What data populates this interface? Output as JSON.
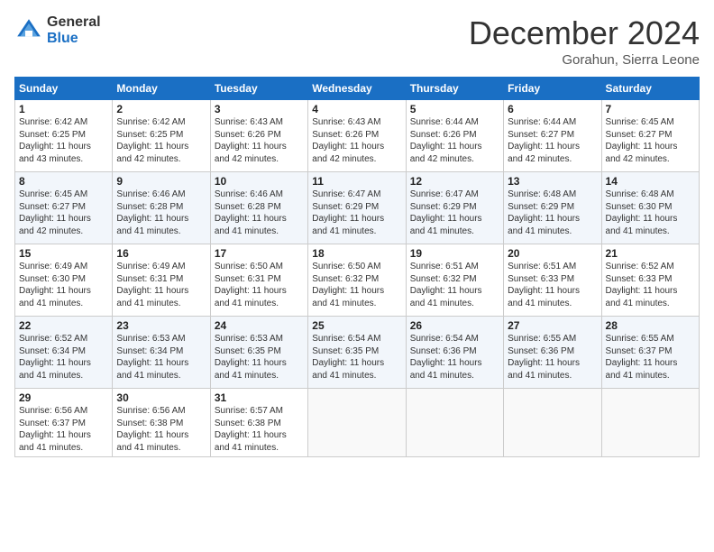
{
  "logo": {
    "general": "General",
    "blue": "Blue"
  },
  "title": "December 2024",
  "subtitle": "Gorahun, Sierra Leone",
  "days_of_week": [
    "Sunday",
    "Monday",
    "Tuesday",
    "Wednesday",
    "Thursday",
    "Friday",
    "Saturday"
  ],
  "weeks": [
    [
      {
        "day": "1",
        "info": "Sunrise: 6:42 AM\nSunset: 6:25 PM\nDaylight: 11 hours\nand 43 minutes."
      },
      {
        "day": "2",
        "info": "Sunrise: 6:42 AM\nSunset: 6:25 PM\nDaylight: 11 hours\nand 42 minutes."
      },
      {
        "day": "3",
        "info": "Sunrise: 6:43 AM\nSunset: 6:26 PM\nDaylight: 11 hours\nand 42 minutes."
      },
      {
        "day": "4",
        "info": "Sunrise: 6:43 AM\nSunset: 6:26 PM\nDaylight: 11 hours\nand 42 minutes."
      },
      {
        "day": "5",
        "info": "Sunrise: 6:44 AM\nSunset: 6:26 PM\nDaylight: 11 hours\nand 42 minutes."
      },
      {
        "day": "6",
        "info": "Sunrise: 6:44 AM\nSunset: 6:27 PM\nDaylight: 11 hours\nand 42 minutes."
      },
      {
        "day": "7",
        "info": "Sunrise: 6:45 AM\nSunset: 6:27 PM\nDaylight: 11 hours\nand 42 minutes."
      }
    ],
    [
      {
        "day": "8",
        "info": "Sunrise: 6:45 AM\nSunset: 6:27 PM\nDaylight: 11 hours\nand 42 minutes."
      },
      {
        "day": "9",
        "info": "Sunrise: 6:46 AM\nSunset: 6:28 PM\nDaylight: 11 hours\nand 41 minutes."
      },
      {
        "day": "10",
        "info": "Sunrise: 6:46 AM\nSunset: 6:28 PM\nDaylight: 11 hours\nand 41 minutes."
      },
      {
        "day": "11",
        "info": "Sunrise: 6:47 AM\nSunset: 6:29 PM\nDaylight: 11 hours\nand 41 minutes."
      },
      {
        "day": "12",
        "info": "Sunrise: 6:47 AM\nSunset: 6:29 PM\nDaylight: 11 hours\nand 41 minutes."
      },
      {
        "day": "13",
        "info": "Sunrise: 6:48 AM\nSunset: 6:29 PM\nDaylight: 11 hours\nand 41 minutes."
      },
      {
        "day": "14",
        "info": "Sunrise: 6:48 AM\nSunset: 6:30 PM\nDaylight: 11 hours\nand 41 minutes."
      }
    ],
    [
      {
        "day": "15",
        "info": "Sunrise: 6:49 AM\nSunset: 6:30 PM\nDaylight: 11 hours\nand 41 minutes."
      },
      {
        "day": "16",
        "info": "Sunrise: 6:49 AM\nSunset: 6:31 PM\nDaylight: 11 hours\nand 41 minutes."
      },
      {
        "day": "17",
        "info": "Sunrise: 6:50 AM\nSunset: 6:31 PM\nDaylight: 11 hours\nand 41 minutes."
      },
      {
        "day": "18",
        "info": "Sunrise: 6:50 AM\nSunset: 6:32 PM\nDaylight: 11 hours\nand 41 minutes."
      },
      {
        "day": "19",
        "info": "Sunrise: 6:51 AM\nSunset: 6:32 PM\nDaylight: 11 hours\nand 41 minutes."
      },
      {
        "day": "20",
        "info": "Sunrise: 6:51 AM\nSunset: 6:33 PM\nDaylight: 11 hours\nand 41 minutes."
      },
      {
        "day": "21",
        "info": "Sunrise: 6:52 AM\nSunset: 6:33 PM\nDaylight: 11 hours\nand 41 minutes."
      }
    ],
    [
      {
        "day": "22",
        "info": "Sunrise: 6:52 AM\nSunset: 6:34 PM\nDaylight: 11 hours\nand 41 minutes."
      },
      {
        "day": "23",
        "info": "Sunrise: 6:53 AM\nSunset: 6:34 PM\nDaylight: 11 hours\nand 41 minutes."
      },
      {
        "day": "24",
        "info": "Sunrise: 6:53 AM\nSunset: 6:35 PM\nDaylight: 11 hours\nand 41 minutes."
      },
      {
        "day": "25",
        "info": "Sunrise: 6:54 AM\nSunset: 6:35 PM\nDaylight: 11 hours\nand 41 minutes."
      },
      {
        "day": "26",
        "info": "Sunrise: 6:54 AM\nSunset: 6:36 PM\nDaylight: 11 hours\nand 41 minutes."
      },
      {
        "day": "27",
        "info": "Sunrise: 6:55 AM\nSunset: 6:36 PM\nDaylight: 11 hours\nand 41 minutes."
      },
      {
        "day": "28",
        "info": "Sunrise: 6:55 AM\nSunset: 6:37 PM\nDaylight: 11 hours\nand 41 minutes."
      }
    ],
    [
      {
        "day": "29",
        "info": "Sunrise: 6:56 AM\nSunset: 6:37 PM\nDaylight: 11 hours\nand 41 minutes."
      },
      {
        "day": "30",
        "info": "Sunrise: 6:56 AM\nSunset: 6:38 PM\nDaylight: 11 hours\nand 41 minutes."
      },
      {
        "day": "31",
        "info": "Sunrise: 6:57 AM\nSunset: 6:38 PM\nDaylight: 11 hours\nand 41 minutes."
      },
      {
        "day": "",
        "info": ""
      },
      {
        "day": "",
        "info": ""
      },
      {
        "day": "",
        "info": ""
      },
      {
        "day": "",
        "info": ""
      }
    ]
  ]
}
